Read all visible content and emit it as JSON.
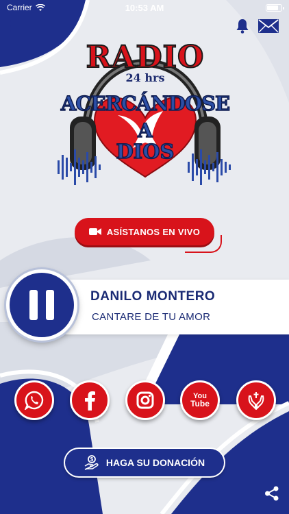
{
  "status_bar": {
    "carrier": "Carrier",
    "time": "10:53 AM"
  },
  "header": {
    "menu_icon": "menu-icon",
    "bell_icon": "bell-icon",
    "mail_icon": "mail-icon"
  },
  "logo": {
    "line1": "RADIO",
    "line2": "24 hrs",
    "line3": "ACERCÁNDOSE",
    "line4": "A",
    "line5": "DIOS"
  },
  "live_button": {
    "label": "ASÍSTANOS EN VIVO",
    "icon": "video-camera-icon"
  },
  "player": {
    "artist": "DANILO MONTERO",
    "song": "CANTARE DE TU AMOR",
    "state_icon": "pause-icon"
  },
  "social": [
    {
      "name": "whatsapp",
      "icon": "whatsapp-icon"
    },
    {
      "name": "facebook",
      "icon": "facebook-icon"
    },
    {
      "name": "instagram",
      "icon": "instagram-icon"
    },
    {
      "name": "youtube",
      "icon": "youtube-icon",
      "label_top": "You",
      "label_bottom": "Tube"
    },
    {
      "name": "prayer",
      "icon": "praying-hands-icon"
    }
  ],
  "donate_button": {
    "label": "HAGA SU DONACIÓN",
    "icon": "donation-hand-icon"
  },
  "share_icon": "share-icon",
  "colors": {
    "brand_red": "#d8131b",
    "brand_blue": "#1e2f8c",
    "text_blue": "#1a2a74",
    "background": "#e9ebf0"
  }
}
